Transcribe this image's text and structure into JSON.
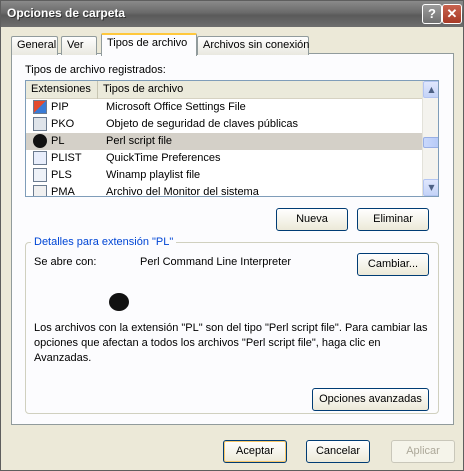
{
  "window": {
    "title": "Opciones de carpeta"
  },
  "titlebar": {
    "help_glyph": "?",
    "close_glyph": "✕"
  },
  "tabs": [
    {
      "label": "General"
    },
    {
      "label": "Ver"
    },
    {
      "label": "Tipos de archivo"
    },
    {
      "label": "Archivos sin conexión"
    }
  ],
  "filetypes": {
    "label": "Tipos de archivo registrados:",
    "columns": [
      "Extensiones",
      "Tipos de archivo"
    ],
    "rows": [
      {
        "ext": "PIP",
        "type": "Microsoft Office Settings File",
        "icon": "office-settings-icon"
      },
      {
        "ext": "PKO",
        "type": "Objeto de seguridad de claves públicas",
        "icon": "certificate-icon"
      },
      {
        "ext": "PL",
        "type": "Perl script file",
        "icon": "perl-file-icon",
        "selected": true
      },
      {
        "ext": "PLIST",
        "type": "QuickTime Preferences",
        "icon": "quicktime-icon"
      },
      {
        "ext": "PLS",
        "type": "Winamp playlist file",
        "icon": "playlist-icon"
      },
      {
        "ext": "PMA",
        "type": "Archivo del Monitor del sistema",
        "icon": "monitor-file-icon"
      }
    ]
  },
  "buttons": {
    "new": "Nueva",
    "delete": "Eliminar",
    "change": "Cambiar...",
    "advanced": "Opciones avanzadas",
    "ok": "Aceptar",
    "cancel": "Cancelar",
    "apply": "Aplicar"
  },
  "details": {
    "title": "Detalles para extensión \"PL\"",
    "opens_with_label": "Se abre con:",
    "opens_with_value": "Perl Command Line Interpreter",
    "description_line1": "Los archivos con la extensión \"PL\" son del tipo \"Perl script file\". Para cambiar las",
    "description_line2": "opciones que afectan a todos los archivos \"Perl script file\", haga clic en",
    "description_line3": "Avanzadas."
  },
  "colors": {
    "accent_tab": "#ffc83c",
    "group_title": "#0046d5",
    "selection": "#d4d0c8"
  }
}
